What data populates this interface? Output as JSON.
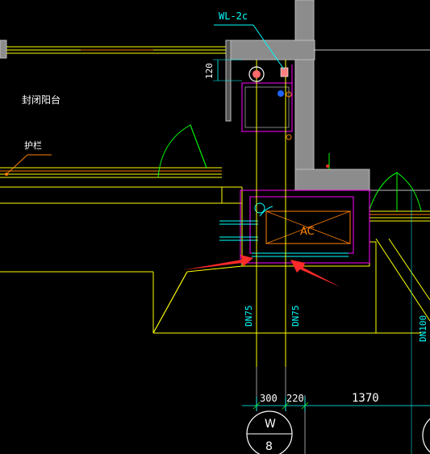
{
  "labels": {
    "pipe_tag": "WL-2c",
    "dim_120": "120",
    "balcony": "封闭阳台",
    "railing": "护栏",
    "ac": "AC",
    "dn75_left": "DN75",
    "dn75_right": "DN75",
    "dn100": "DN100",
    "dim_300": "300",
    "dim_220": "220",
    "dim_1370": "1370",
    "axis_letter": "W",
    "axis_number": "8"
  },
  "colors": {
    "background": "#000000",
    "wall_fill": "#8c8c8c",
    "yellow": "#ffff00",
    "cyan": "#00ffff",
    "magenta": "#ff00ff",
    "green": "#00ff00",
    "orange": "#ff8000",
    "red": "#ff3b30",
    "white": "#ffffff",
    "arrow": "#ff2a2a"
  }
}
